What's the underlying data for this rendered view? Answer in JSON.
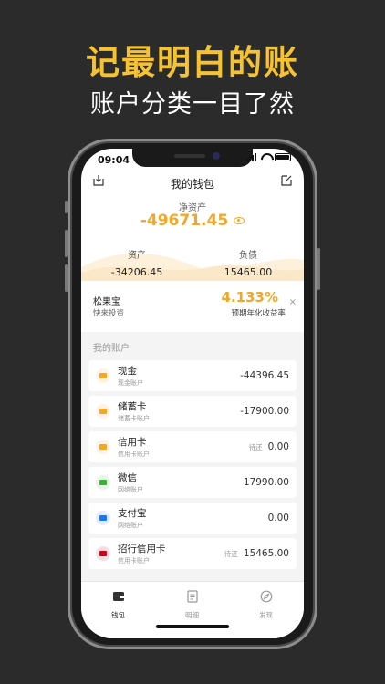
{
  "marketing": {
    "headline": "记最明白的账",
    "subline": "账户分类一目了然"
  },
  "status_bar": {
    "time": "09:04"
  },
  "nav": {
    "title": "我的钱包"
  },
  "summary": {
    "net_worth_label": "净资产",
    "net_worth_value": "-49671.45",
    "assets_label": "资产",
    "assets_value": "-34206.45",
    "liabilities_label": "负债",
    "liabilities_value": "15465.00"
  },
  "promo": {
    "name": "松果宝",
    "subtitle": "快来投资",
    "rate": "4.133%",
    "rate_label": "预期年化收益率",
    "close": "×"
  },
  "accounts_section": {
    "title": "我的账户"
  },
  "accounts": [
    {
      "name": "现金",
      "type": "现金账户",
      "due": "",
      "value": "-44396.45",
      "icon": "wallet-icon",
      "color": "#f5a623"
    },
    {
      "name": "储蓄卡",
      "type": "储蓄卡账户",
      "due": "",
      "value": "-17900.00",
      "icon": "card-icon",
      "color": "#f5a623"
    },
    {
      "name": "信用卡",
      "type": "信用卡账户",
      "due": "待还",
      "value": "0.00",
      "icon": "credit-card-icon",
      "color": "#f5a623"
    },
    {
      "name": "微信",
      "type": "网络账户",
      "due": "",
      "value": "17990.00",
      "icon": "wechat-icon",
      "color": "#3cb034"
    },
    {
      "name": "支付宝",
      "type": "网络账户",
      "due": "",
      "value": "0.00",
      "icon": "alipay-icon",
      "color": "#1677ff"
    },
    {
      "name": "招行信用卡",
      "type": "信用卡账户",
      "due": "待还",
      "value": "15465.00",
      "icon": "cmb-icon",
      "color": "#d0021b"
    }
  ],
  "tabs": [
    {
      "label": "钱包",
      "icon": "wallet-tab-icon",
      "active": true
    },
    {
      "label": "明细",
      "icon": "list-tab-icon",
      "active": false
    },
    {
      "label": "发现",
      "icon": "compass-tab-icon",
      "active": false
    }
  ]
}
